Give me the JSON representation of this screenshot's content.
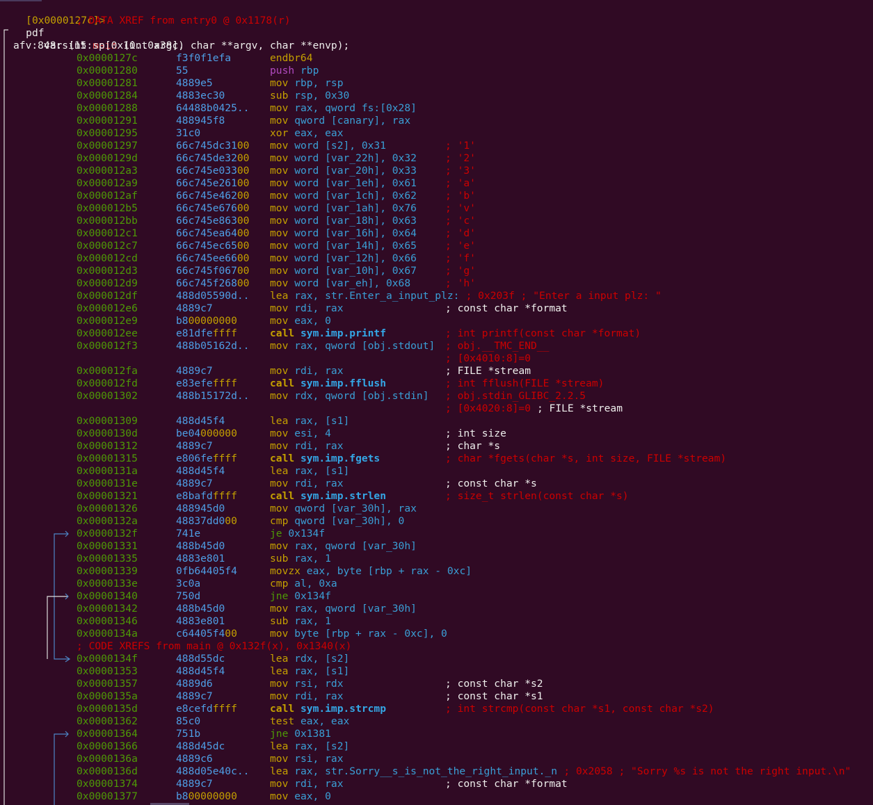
{
  "prompt": {
    "address": "[0x0000127c]>",
    "command": "pdf"
  },
  "xref_header": "; DATA XREF from entry0 @ 0x1178(r)",
  "signature": {
    "prefix": "848: int ",
    "name": "main",
    "args": " (int argc, char **argv, char **envp);"
  },
  "afv_line": "afv: vars(15:sp[0x10..0x38])",
  "code_xref": "; CODE XREFS from main @ 0x132f(x), 0x1340(x)",
  "rows": [
    {
      "addr": "0x0000127c",
      "bytes": "f3f0f1efa",
      "mn": "endbr64",
      "ops": "",
      "cm": "",
      "cmc": "r"
    },
    {
      "addr": "0x00001280",
      "bytes": "55",
      "mn": "push",
      "mnc": "m",
      "ops": "rbp",
      "cm": "",
      "cmc": "r"
    },
    {
      "addr": "0x00001281",
      "bytes": "4889e5",
      "mn": "mov",
      "ops": "rbp, rsp",
      "cm": "",
      "cmc": "r"
    },
    {
      "addr": "0x00001284",
      "bytes": "4883ec30",
      "mn": "sub",
      "ops": "rsp, 0x30",
      "cm": "",
      "cmc": "r"
    },
    {
      "addr": "0x00001288",
      "bytes": "64488b0425..",
      "mn": "mov",
      "ops": "rax, qword fs:[0x28]",
      "cm": "",
      "cmc": "r"
    },
    {
      "addr": "0x00001291",
      "bytes": "488945f8",
      "mn": "mov",
      "ops": "qword [canary], rax",
      "cm": "",
      "cmc": "r"
    },
    {
      "addr": "0x00001295",
      "bytes": "31c0",
      "mn": "xor",
      "ops": "eax, eax",
      "cm": "",
      "cmc": "r"
    },
    {
      "addr": "0x00001297",
      "bytes": "66c745dc3100",
      "mn": "mov",
      "ops": "word [s2], 0x31",
      "cm": "; '1'",
      "cmc": "r"
    },
    {
      "addr": "0x0000129d",
      "bytes": "66c745de3200",
      "mn": "mov",
      "ops": "word [var_22h], 0x32",
      "cm": "; '2'",
      "cmc": "r"
    },
    {
      "addr": "0x000012a3",
      "bytes": "66c745e03300",
      "mn": "mov",
      "ops": "word [var_20h], 0x33",
      "cm": "; '3'",
      "cmc": "r"
    },
    {
      "addr": "0x000012a9",
      "bytes": "66c745e26100",
      "mn": "mov",
      "ops": "word [var_1eh], 0x61",
      "cm": "; 'a'",
      "cmc": "r"
    },
    {
      "addr": "0x000012af",
      "bytes": "66c745e46200",
      "mn": "mov",
      "ops": "word [var_1ch], 0x62",
      "cm": "; 'b'",
      "cmc": "r"
    },
    {
      "addr": "0x000012b5",
      "bytes": "66c745e67600",
      "mn": "mov",
      "ops": "word [var_1ah], 0x76",
      "cm": "; 'v'",
      "cmc": "r"
    },
    {
      "addr": "0x000012bb",
      "bytes": "66c745e86300",
      "mn": "mov",
      "ops": "word [var_18h], 0x63",
      "cm": "; 'c'",
      "cmc": "r"
    },
    {
      "addr": "0x000012c1",
      "bytes": "66c745ea6400",
      "mn": "mov",
      "ops": "word [var_16h], 0x64",
      "cm": "; 'd'",
      "cmc": "r"
    },
    {
      "addr": "0x000012c7",
      "bytes": "66c745ec6500",
      "mn": "mov",
      "ops": "word [var_14h], 0x65",
      "cm": "; 'e'",
      "cmc": "r"
    },
    {
      "addr": "0x000012cd",
      "bytes": "66c745ee6600",
      "mn": "mov",
      "ops": "word [var_12h], 0x66",
      "cm": "; 'f'",
      "cmc": "r"
    },
    {
      "addr": "0x000012d3",
      "bytes": "66c745f06700",
      "mn": "mov",
      "ops": "word [var_10h], 0x67",
      "cm": "; 'g'",
      "cmc": "r"
    },
    {
      "addr": "0x000012d9",
      "bytes": "66c745f26800",
      "mn": "mov",
      "ops": "word [var_eh], 0x68",
      "cm": "; 'h'",
      "cmc": "r"
    },
    {
      "addr": "0x000012df",
      "bytes": "488d05590d..",
      "mn": "lea",
      "ops": "rax, str.Enter_a_input_plz:",
      "cm": "; 0x203f ; \"Enter a input plz: \"",
      "cmc": "r",
      "inline": true
    },
    {
      "addr": "0x000012e6",
      "bytes": "4889c7",
      "mn": "mov",
      "ops": "rdi, rax",
      "cm": "; const char *format",
      "cmc": "w"
    },
    {
      "addr": "0x000012e9",
      "bytes": "b800000000",
      "mn": "mov",
      "ops": "eax, 0",
      "cm": "",
      "cmc": "r"
    },
    {
      "addr": "0x000012ee",
      "bytes": "e81dfeffff",
      "mn": "call",
      "ops": "sym.imp.printf",
      "call": true,
      "cm": "; int printf(const char *format)",
      "cmc": "r"
    },
    {
      "addr": "0x000012f3",
      "bytes": "488b05162d..",
      "mn": "mov",
      "ops": "rax, qword [obj.stdout]",
      "cm": "; obj.__TMC_END__",
      "cmc": "r"
    },
    {
      "addr": "",
      "bytes": "",
      "mn": "",
      "ops": "",
      "cm": "; [0x4010:8]=0",
      "cmc": "r"
    },
    {
      "addr": "0x000012fa",
      "bytes": "4889c7",
      "mn": "mov",
      "ops": "rdi, rax",
      "cm": "; FILE *stream",
      "cmc": "w"
    },
    {
      "addr": "0x000012fd",
      "bytes": "e83efeffff",
      "mn": "call",
      "ops": "sym.imp.fflush",
      "call": true,
      "cm": "; int fflush(FILE *stream)",
      "cmc": "r"
    },
    {
      "addr": "0x00001302",
      "bytes": "488b15172d..",
      "mn": "mov",
      "ops": "rdx, qword [obj.stdin]",
      "cm": "; obj.stdin_GLIBC_2.2.5",
      "cmc": "r"
    },
    {
      "addr": "",
      "bytes": "",
      "mn": "",
      "ops": "",
      "cm": "; [0x4020:8]=0",
      "cm2": " ; FILE *stream",
      "cmc": "r"
    },
    {
      "addr": "0x00001309",
      "bytes": "488d45f4",
      "mn": "lea",
      "ops": "rax, [s1]",
      "cm": "",
      "cmc": "r"
    },
    {
      "addr": "0x0000130d",
      "bytes": "be04000000",
      "mn": "mov",
      "ops": "esi, 4",
      "cm": "; int size",
      "cmc": "w"
    },
    {
      "addr": "0x00001312",
      "bytes": "4889c7",
      "mn": "mov",
      "ops": "rdi, rax",
      "cm": "; char *s",
      "cmc": "w"
    },
    {
      "addr": "0x00001315",
      "bytes": "e806feffff",
      "mn": "call",
      "ops": "sym.imp.fgets",
      "call": true,
      "cm": "; char *fgets(char *s, int size, FILE *stream)",
      "cmc": "r"
    },
    {
      "addr": "0x0000131a",
      "bytes": "488d45f4",
      "mn": "lea",
      "ops": "rax, [s1]",
      "cm": "",
      "cmc": "r"
    },
    {
      "addr": "0x0000131e",
      "bytes": "4889c7",
      "mn": "mov",
      "ops": "rdi, rax",
      "cm": "; const char *s",
      "cmc": "w"
    },
    {
      "addr": "0x00001321",
      "bytes": "e8bafdffff",
      "mn": "call",
      "ops": "sym.imp.strlen",
      "call": true,
      "cm": "; size_t strlen(const char *s)",
      "cmc": "r"
    },
    {
      "addr": "0x00001326",
      "bytes": "488945d0",
      "mn": "mov",
      "ops": "qword [var_30h], rax",
      "cm": "",
      "cmc": "r"
    },
    {
      "addr": "0x0000132a",
      "bytes": "48837dd000",
      "mn": "cmp",
      "ops": "qword [var_30h], 0",
      "cm": "",
      "cmc": "r"
    },
    {
      "addr": "0x0000132f",
      "bytes": "741e",
      "mn": "je",
      "mnc": "g",
      "ops": "0x134f",
      "cm": "",
      "cmc": "r"
    },
    {
      "addr": "0x00001331",
      "bytes": "488b45d0",
      "mn": "mov",
      "ops": "rax, qword [var_30h]",
      "cm": "",
      "cmc": "r"
    },
    {
      "addr": "0x00001335",
      "bytes": "4883e801",
      "mn": "sub",
      "ops": "rax, 1",
      "cm": "",
      "cmc": "r"
    },
    {
      "addr": "0x00001339",
      "bytes": "0fb64405f4",
      "mn": "movzx",
      "ops": "eax, byte [rbp + rax - 0xc]",
      "cm": "",
      "cmc": "r"
    },
    {
      "addr": "0x0000133e",
      "bytes": "3c0a",
      "mn": "cmp",
      "ops": "al, 0xa",
      "cm": "",
      "cmc": "r"
    },
    {
      "addr": "0x00001340",
      "bytes": "750d",
      "mn": "jne",
      "mnc": "g",
      "ops": "0x134f",
      "cm": "",
      "cmc": "r"
    },
    {
      "addr": "0x00001342",
      "bytes": "488b45d0",
      "mn": "mov",
      "ops": "rax, qword [var_30h]",
      "cm": "",
      "cmc": "r"
    },
    {
      "addr": "0x00001346",
      "bytes": "4883e801",
      "mn": "sub",
      "ops": "rax, 1",
      "cm": "",
      "cmc": "r"
    },
    {
      "addr": "0x0000134a",
      "bytes": "c64405f400",
      "mn": "mov",
      "ops": "byte [rbp + rax - 0xc], 0",
      "cm": "",
      "cmc": "r"
    },
    {
      "xref": true
    },
    {
      "addr": "0x0000134f",
      "bytes": "488d55dc",
      "mn": "lea",
      "ops": "rdx, [s2]",
      "cm": "",
      "cmc": "r"
    },
    {
      "addr": "0x00001353",
      "bytes": "488d45f4",
      "mn": "lea",
      "ops": "rax, [s1]",
      "cm": "",
      "cmc": "r"
    },
    {
      "addr": "0x00001357",
      "bytes": "4889d6",
      "mn": "mov",
      "ops": "rsi, rdx",
      "cm": "; const char *s2",
      "cmc": "w"
    },
    {
      "addr": "0x0000135a",
      "bytes": "4889c7",
      "mn": "mov",
      "ops": "rdi, rax",
      "cm": "; const char *s1",
      "cmc": "w"
    },
    {
      "addr": "0x0000135d",
      "bytes": "e8cefdffff",
      "mn": "call",
      "ops": "sym.imp.strcmp",
      "call": true,
      "cm": "; int strcmp(const char *s1, const char *s2)",
      "cmc": "r"
    },
    {
      "addr": "0x00001362",
      "bytes": "85c0",
      "mn": "test",
      "ops": "eax, eax",
      "cm": "",
      "cmc": "r"
    },
    {
      "addr": "0x00001364",
      "bytes": "751b",
      "mn": "jne",
      "mnc": "g",
      "ops": "0x1381",
      "cm": "",
      "cmc": "r"
    },
    {
      "addr": "0x00001366",
      "bytes": "488d45dc",
      "mn": "lea",
      "ops": "rax, [s2]",
      "cm": "",
      "cmc": "r"
    },
    {
      "addr": "0x0000136a",
      "bytes": "4889c6",
      "mn": "mov",
      "ops": "rsi, rax",
      "cm": "",
      "cmc": "r"
    },
    {
      "addr": "0x0000136d",
      "bytes": "488d05e40c..",
      "mn": "lea",
      "ops": "rax, str.Sorry__s_is_not_the_right_input._n",
      "cm": "; 0x2058 ; \"Sorry %s is not the right input.\\n\"",
      "cmc": "r",
      "inline": true
    },
    {
      "addr": "0x00001374",
      "bytes": "4889c7",
      "mn": "mov",
      "ops": "rdi, rax",
      "cm": "; const char *format",
      "cmc": "w"
    },
    {
      "addr": "0x00001377",
      "bytes": "b800000000",
      "mn": "mov",
      "ops": "eax, 0",
      "cm": "",
      "cmc": "r"
    }
  ],
  "colors": {
    "background": "#300a24",
    "address": "#4e9a06",
    "bytes_ff": "#c4a000",
    "comment": "#cc0000",
    "push": "#b04ac0",
    "call_target": "#34a7e6",
    "jump_arrows": "#4d87c7"
  }
}
